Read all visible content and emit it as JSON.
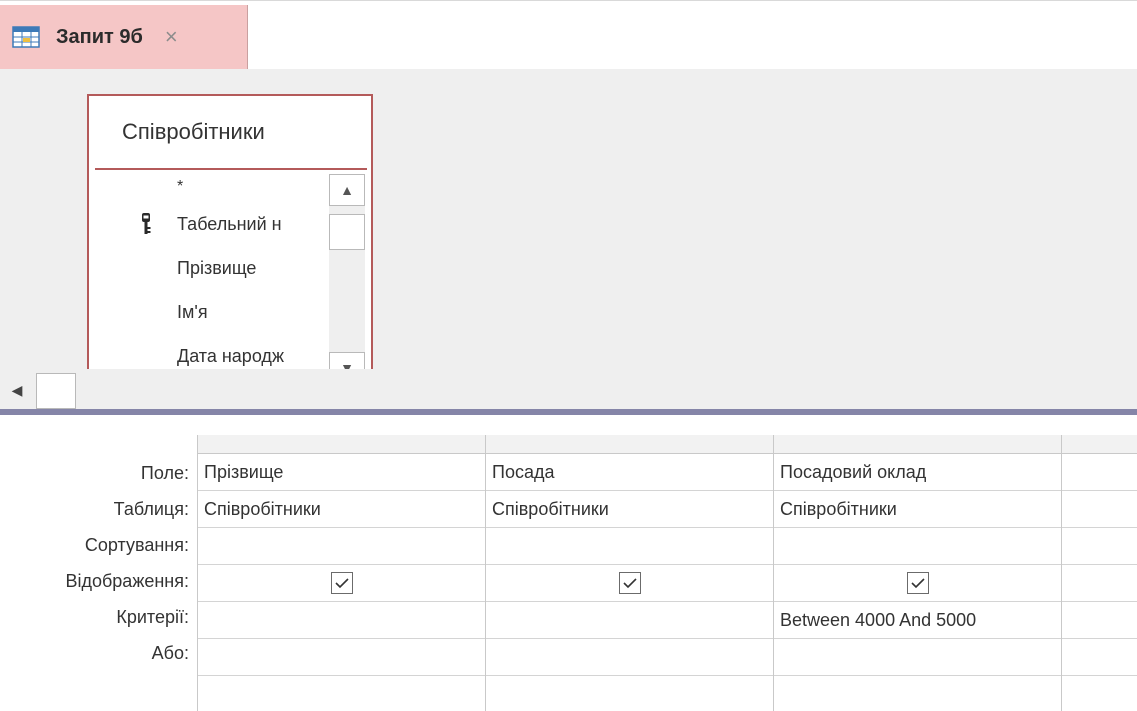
{
  "tab": {
    "title": "Запит 9б",
    "close_glyph": "×",
    "icon": "query-design-icon"
  },
  "table_box": {
    "title": "Співробітники",
    "fields": [
      {
        "label": "*"
      },
      {
        "label": "Табельний н",
        "key": true
      },
      {
        "label": "Прізвище"
      },
      {
        "label": "Ім'я"
      },
      {
        "label": "Дата народж"
      }
    ]
  },
  "row_labels": {
    "field": "Поле:",
    "table": "Таблиця:",
    "sort": "Сортування:",
    "show": "Відображення:",
    "criteria": "Критерії:",
    "or": "Або:"
  },
  "columns": [
    {
      "field": "Прізвище",
      "table": "Співробітники",
      "sort": "",
      "show": true,
      "criteria": "",
      "or": ""
    },
    {
      "field": "Посада",
      "table": "Співробітники",
      "sort": "",
      "show": true,
      "criteria": "",
      "or": ""
    },
    {
      "field": "Посадовий оклад",
      "table": "Співробітники",
      "sort": "",
      "show": true,
      "criteria": "Between 4000 And 5000",
      "or": ""
    },
    {
      "field": "",
      "table": "",
      "sort": "",
      "show": false,
      "criteria": "",
      "or": ""
    }
  ],
  "colors": {
    "tab_bg": "#f5c6c6",
    "table_border": "#b45a5a",
    "splitter": "#8585a8"
  }
}
